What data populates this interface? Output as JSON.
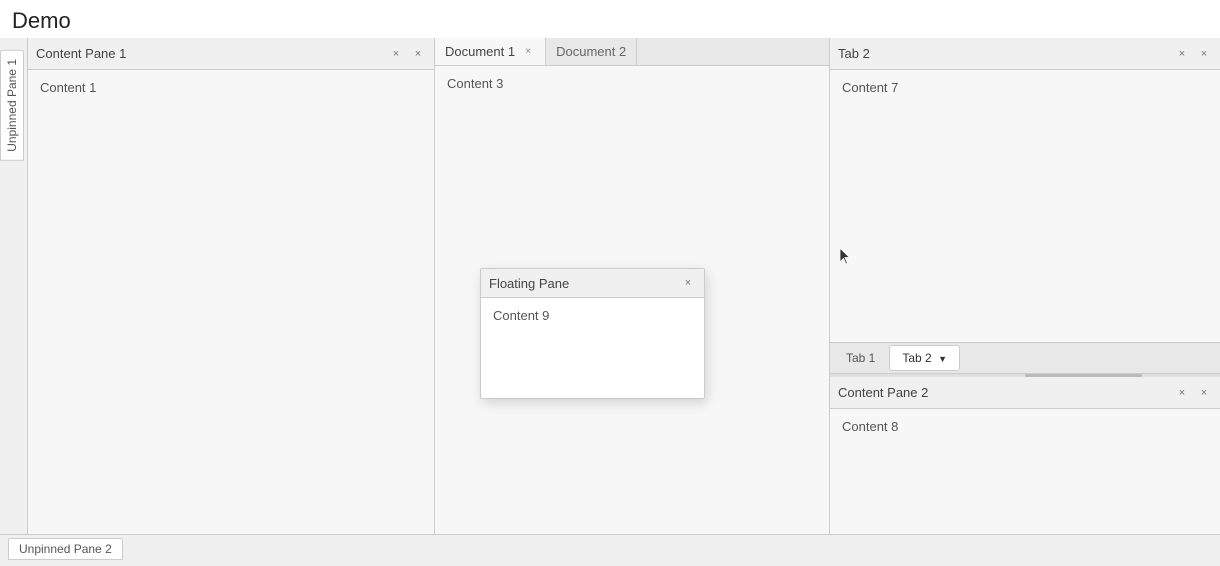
{
  "app": {
    "title": "Demo"
  },
  "left_section": {
    "unpinned_pane_label": "Unpinned Pane 1",
    "content_pane": {
      "title": "Content Pane 1",
      "content": "Content 1",
      "pin_icon": "×",
      "close_icon": "×"
    }
  },
  "middle_section": {
    "tabs": [
      {
        "label": "Document 1",
        "active": true,
        "closeable": true
      },
      {
        "label": "Document 2",
        "active": false,
        "closeable": false
      }
    ],
    "content": "Content 3"
  },
  "right_section": {
    "top_pane": {
      "title": "Tab 2",
      "content": "Content 7",
      "pin_icon": "×",
      "close_icon": "×"
    },
    "tabs_bar": {
      "tabs": [
        {
          "label": "Tab 1",
          "active": false
        },
        {
          "label": "Tab 2",
          "active": true,
          "has_dropdown": true
        }
      ]
    },
    "bottom_pane": {
      "title": "Content Pane 2",
      "content": "Content 8",
      "pin_icon": "×",
      "close_icon": "×"
    }
  },
  "floating_pane": {
    "title": "Floating Pane",
    "content": "Content 9",
    "close_icon": "×"
  },
  "bottom_bar": {
    "unpinned_pane_label": "Unpinned Pane 2"
  }
}
